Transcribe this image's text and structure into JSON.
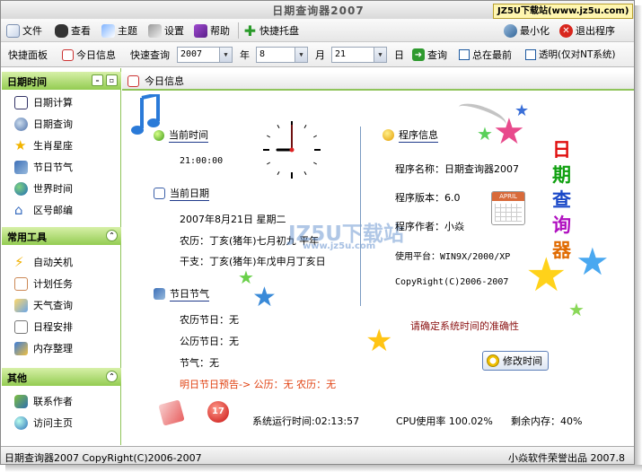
{
  "window": {
    "title": "日期查询器2007",
    "site_badge": "JZ5U下载站(www.jz5u.com)"
  },
  "menu": {
    "items": [
      "文件",
      "查看",
      "主题",
      "设置",
      "帮助",
      "快捷托盘"
    ],
    "minimize": "最小化",
    "exit": "退出程序"
  },
  "toolbar": {
    "panel": "快捷面板",
    "today": "今日信息",
    "quick_query": "快速查询",
    "year_value": "2007",
    "year_unit": "年",
    "month_value": "8",
    "month_unit": "月",
    "day_value": "21",
    "day_unit": "日",
    "query": "查询",
    "always_top": "总在最前",
    "transparent": "透明(仅对NT系统)"
  },
  "sidebar": {
    "sections": [
      {
        "title": "日期时间",
        "items": [
          "日期计算",
          "日期查询",
          "生肖星座",
          "节日节气",
          "世界时间",
          "区号邮编"
        ]
      },
      {
        "title": "常用工具",
        "items": [
          "自动关机",
          "计划任务",
          "天气查询",
          "日程安排",
          "内存整理"
        ]
      },
      {
        "title": "其他",
        "items": [
          "联系作者",
          "访问主页"
        ]
      }
    ]
  },
  "content": {
    "header": "今日信息",
    "current_time": {
      "heading": "当前时间",
      "value": "21:00:00"
    },
    "current_date": {
      "heading": "当前日期",
      "solar": "2007年8月21日  星期二",
      "lunar": "农历：丁亥(猪年)七月初九  平年",
      "ganzhi": "干支：丁亥(猪年)年戊申月丁亥日"
    },
    "festival": {
      "heading": "节日节气",
      "lunar_festival": "农历节日：无",
      "solar_festival": "公历节日：无",
      "solar_term": "节气：无",
      "tomorrow": "明日节日预告-> 公历：无 农历：无"
    },
    "program_info": {
      "heading": "程序信息",
      "name": "程序名称：日期查询器2007",
      "version": "程序版本：6.0",
      "author": "程序作者：小焱",
      "platform": "使用平台：WIN9X/2000/XP",
      "copyright": "CopyRight(C)2006-2007"
    },
    "warning": "请确定系统时间的准确性",
    "modify_button": "修改时间",
    "calendar_icon_text": "APRIL",
    "side_title_chars": [
      "日",
      "期",
      "查",
      "询",
      "器"
    ],
    "watermark_main": "JZ5U下载站",
    "watermark_url": "www.jz5u.com",
    "stats": {
      "uptime": "系统运行时间:02:13:57",
      "cpu": "CPU使用率 100.02%",
      "memory": "剩余内存：40%"
    }
  },
  "status": {
    "left": "日期查询器2007 CopyRight(C)2006-2007",
    "right": "小焱软件荣誉出品  2007.8"
  },
  "clock": {
    "hour": 9,
    "minute": 0,
    "second": 0
  }
}
